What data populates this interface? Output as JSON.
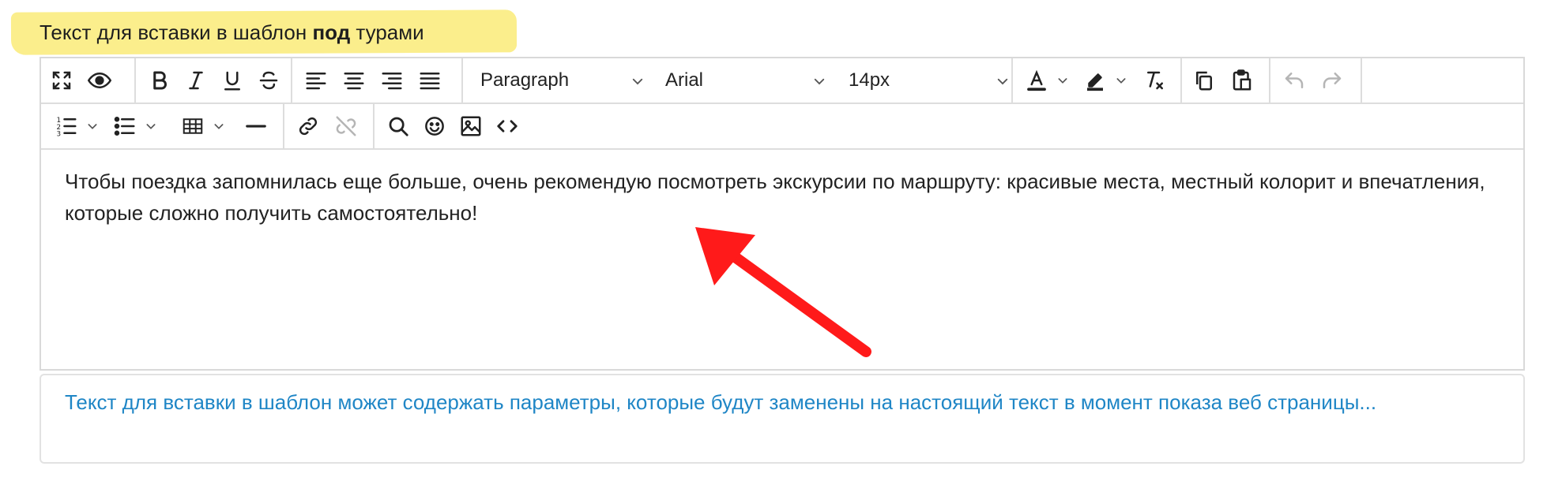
{
  "field_label": {
    "prefix": "Текст для вставки в шаблон ",
    "bold": "под",
    "suffix": " турами"
  },
  "toolbar": {
    "block_format": "Paragraph",
    "font_family": "Arial",
    "font_size": "14px"
  },
  "editor": {
    "content": "Чтобы поездка запомнилась еще больше, очень рекомендую посмотреть экскурсии по маршруту: красивые места, местный колорит и впечатления, которые сложно получить самостоятельно!"
  },
  "hint": {
    "text": "Текст для вставки в шаблон может содержать параметры, которые будут заменены на настоящий текст в момент показа веб страницы..."
  },
  "colors": {
    "label_highlight": "#fbee8c",
    "hint_text": "#1f86c6",
    "arrow": "#ff1a1a"
  },
  "icons": [
    "fullscreen-icon",
    "preview-eye-icon",
    "bold-icon",
    "italic-icon",
    "underline-icon",
    "strikethrough-icon",
    "align-left-icon",
    "align-center-icon",
    "align-right-icon",
    "align-justify-icon",
    "text-color-icon",
    "highlight-icon",
    "clear-format-icon",
    "copy-icon",
    "paste-icon",
    "undo-icon",
    "redo-icon",
    "numbered-list-icon",
    "bulleted-list-icon",
    "table-icon",
    "horizontal-line-icon",
    "link-icon",
    "unlink-icon",
    "search-icon",
    "emoji-icon",
    "image-icon",
    "code-icon"
  ]
}
